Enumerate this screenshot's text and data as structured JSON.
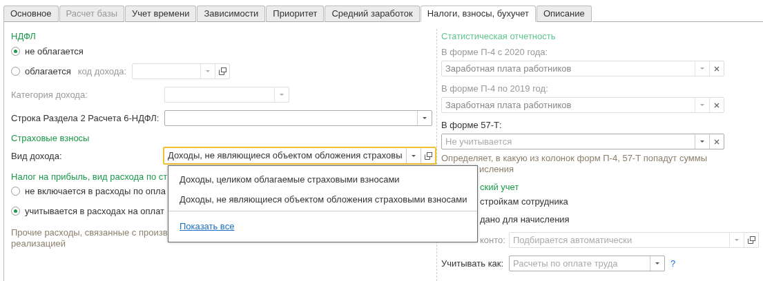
{
  "tabs": [
    {
      "label": "Основное",
      "selected": false,
      "disabled": false
    },
    {
      "label": "Расчет базы",
      "selected": false,
      "disabled": true
    },
    {
      "label": "Учет времени",
      "selected": false,
      "disabled": false
    },
    {
      "label": "Зависимости",
      "selected": false,
      "disabled": false
    },
    {
      "label": "Приоритет",
      "selected": false,
      "disabled": false
    },
    {
      "label": "Средний заработок",
      "selected": false,
      "disabled": false
    },
    {
      "label": "Налоги, взносы, бухучет",
      "selected": true,
      "disabled": false
    },
    {
      "label": "Описание",
      "selected": false,
      "disabled": false
    }
  ],
  "left": {
    "ndfl": {
      "heading": "НДФЛ",
      "options": [
        {
          "label": "не облагается",
          "checked": true
        },
        {
          "label": "облагается",
          "checked": false,
          "field_label": "код дохода:",
          "field": {
            "disabled": true,
            "buttons": [
              {
                "kind": "dropdown"
              },
              {
                "kind": "open"
              }
            ]
          }
        }
      ]
    },
    "income_category": {
      "label": "Категория дохода:",
      "field": {
        "disabled": true,
        "buttons": [
          {
            "kind": "dropdown"
          }
        ]
      }
    },
    "line_6ndfl": {
      "label": "Строка Раздела 2 Расчета 6-НДФЛ:",
      "field": {
        "disabled": false,
        "buttons": [
          {
            "kind": "dropdown"
          }
        ]
      }
    },
    "insurance": {
      "heading": "Страховые взносы",
      "label": "Вид дохода:",
      "field": {
        "value": "Доходы, не являющиеся объектом обложения страховы",
        "disabled": false,
        "focused": true,
        "buttons": [
          {
            "kind": "dropdown"
          },
          {
            "kind": "open"
          }
        ]
      }
    },
    "profit_tax": {
      "heading": "Налог на прибыль, вид расхода по ст",
      "options": [
        {
          "label": "не включается в расходы по опла",
          "checked": false
        },
        {
          "label": "учитывается в расходах на оплат",
          "checked": true
        }
      ],
      "note_lines": [
        "Прочие расходы, связанные с произв",
        "реализацией"
      ]
    }
  },
  "right": {
    "heading": "Статистическая отчетность",
    "heading_disabled": true,
    "p4_2020": {
      "label": "В форме П-4 с 2020 года:",
      "field": {
        "value": "Заработная плата работников",
        "disabled": true,
        "buttons": [
          {
            "kind": "dropdown"
          },
          {
            "kind": "clear"
          }
        ]
      }
    },
    "p4_2019": {
      "label": "В форме П-4 по 2019 год:",
      "field": {
        "value": "Заработная плата работников",
        "disabled": true,
        "buttons": [
          {
            "kind": "dropdown"
          },
          {
            "kind": "clear"
          }
        ]
      }
    },
    "f57t": {
      "label": "В форме 57-Т:",
      "field": {
        "placeholder": "Не учитывается",
        "disabled": false,
        "buttons": [
          {
            "kind": "dropdown"
          },
          {
            "kind": "clear"
          }
        ]
      }
    },
    "note_lines": [
      "Определяет, в какую из колонок форм П-4, 57-Т попадут суммы",
      "исления"
    ],
    "accounting_heading": "ский учет",
    "texts": [
      "стройкам сотрудника",
      "дано для начисления"
    ],
    "subconto": {
      "label": "конто:",
      "field": {
        "placeholder": "Подбирается автоматически",
        "disabled": true,
        "buttons": [
          {
            "kind": "dropdown"
          },
          {
            "kind": "open"
          }
        ]
      }
    },
    "account_as": {
      "label": "Учитывать как:",
      "field": {
        "placeholder": "Расчеты по оплате труда",
        "disabled": false,
        "buttons": [
          {
            "kind": "dropdown"
          }
        ]
      },
      "help": "?"
    }
  },
  "popup": {
    "items": [
      "Доходы, целиком облагаемые страховыми взносами",
      "Доходы, не являющиеся объектом обложения страховыми взносами"
    ],
    "link": "Показать все"
  }
}
